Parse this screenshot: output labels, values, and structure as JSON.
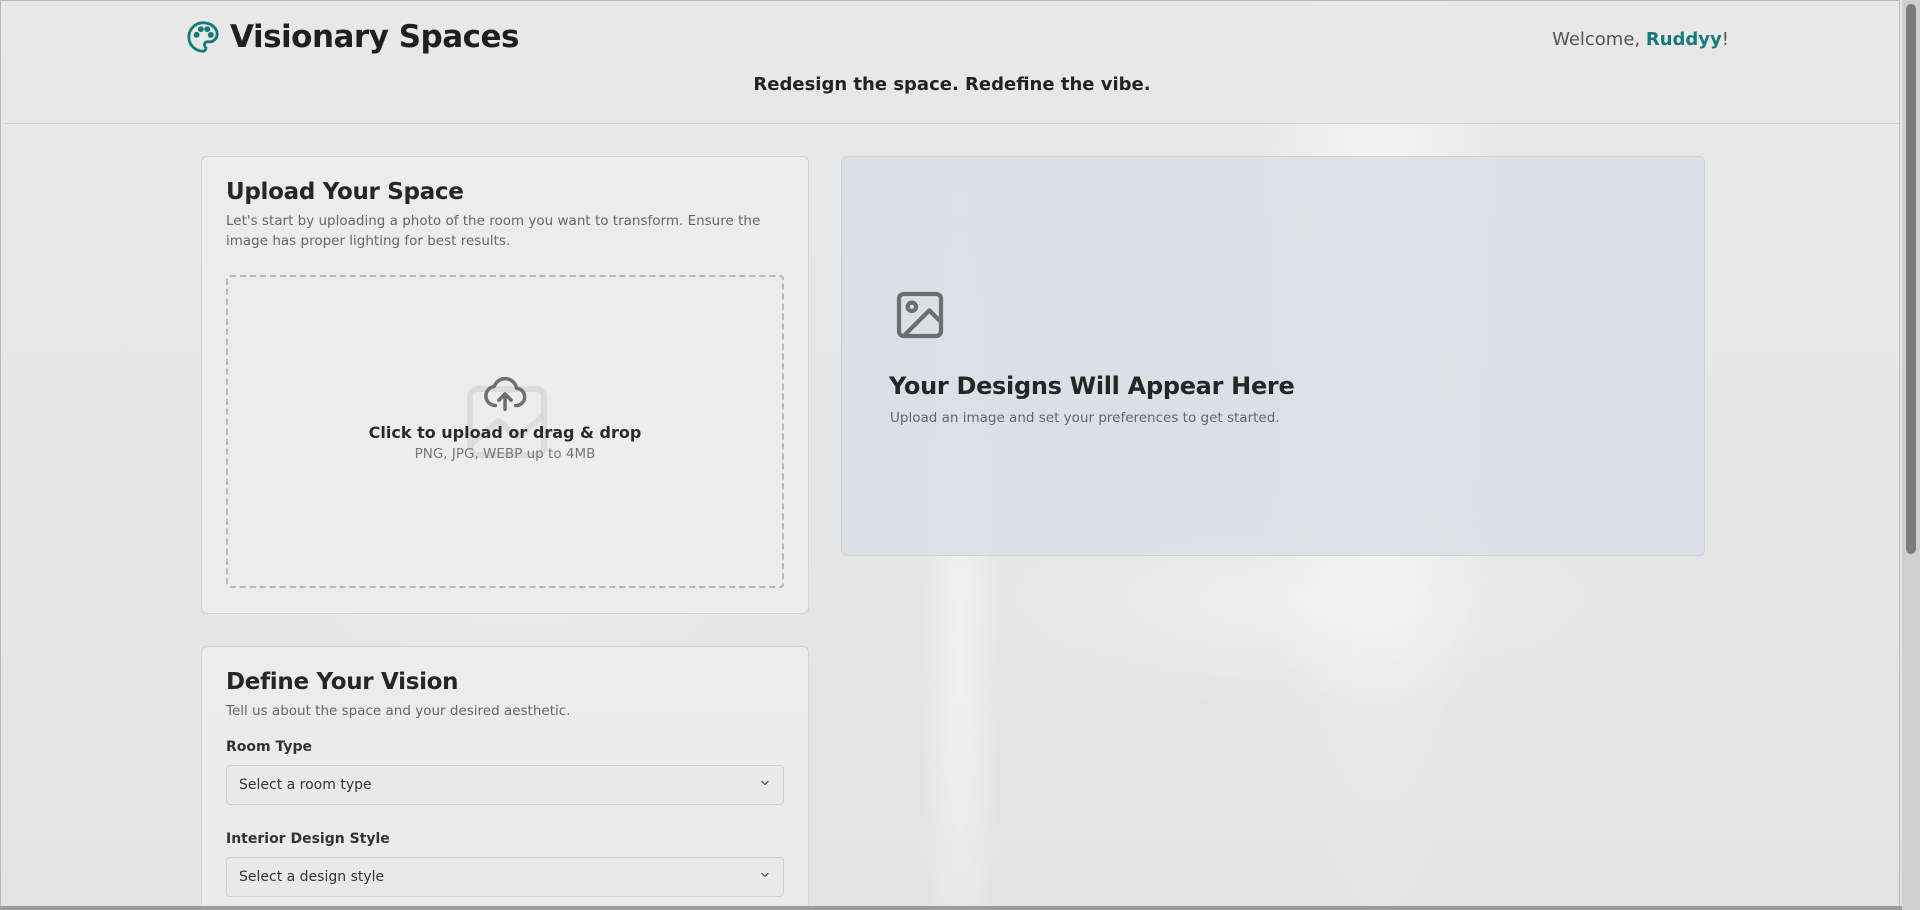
{
  "header": {
    "brand_name": "Visionary Spaces",
    "brand_icon": "palette-icon",
    "welcome_prefix": "Welcome, ",
    "username": "Ruddyy",
    "welcome_suffix": "!",
    "tagline": "Redesign the space. Redefine the vibe.",
    "accent_color": "#157a78"
  },
  "upload": {
    "title": "Upload Your Space",
    "description": "Let's start by uploading a photo of the room you want to transform. Ensure the image has proper lighting for best results.",
    "dropzone_title": "Click to upload or drag & drop",
    "dropzone_subtitle": "PNG, JPG, WEBP up to 4MB",
    "icon": "cloud-upload-icon"
  },
  "vision": {
    "title": "Define Your Vision",
    "description": "Tell us about the space and your desired aesthetic.",
    "room_type_label": "Room Type",
    "room_type_value": "Select a room type",
    "style_label": "Interior Design Style",
    "style_value": "Select a design style"
  },
  "results": {
    "title": "Your Designs Will Appear Here",
    "subtitle": "Upload an image and set your preferences to get started.",
    "icon": "image-icon"
  }
}
